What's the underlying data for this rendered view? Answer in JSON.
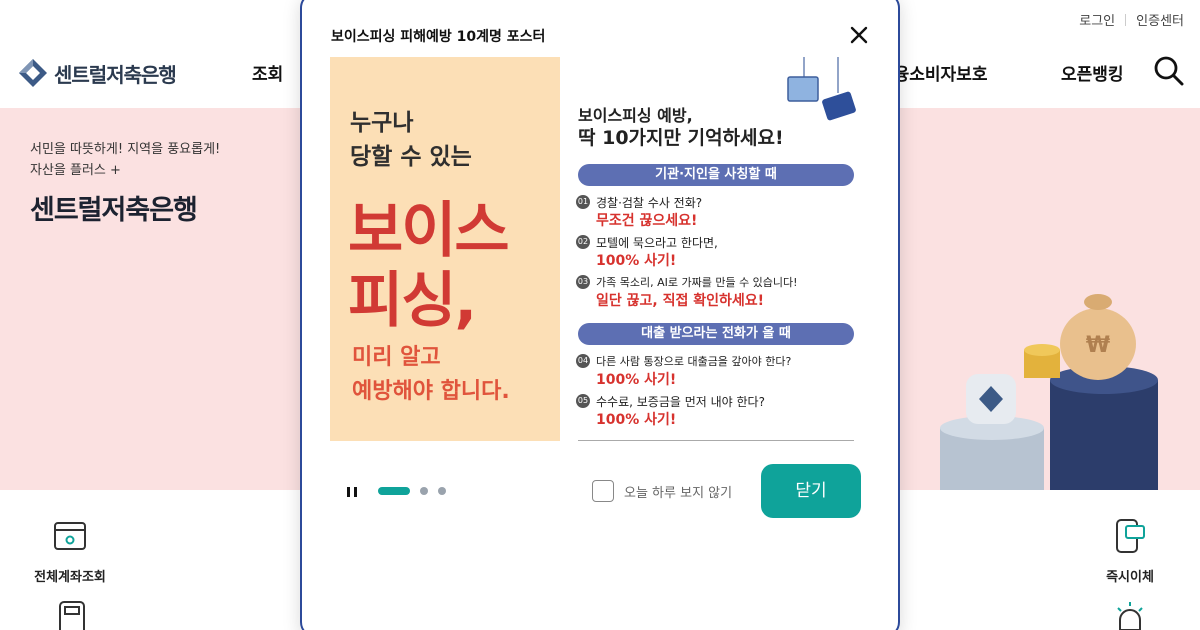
{
  "header": {
    "util_links": [
      "로그인",
      "인증센터"
    ],
    "bank_name": "센트럴저축은행",
    "menu": [
      "조회",
      "금융소비자보호",
      "오픈뱅킹"
    ],
    "search_icon": "search-icon"
  },
  "hero": {
    "slogan_line1": "서민을 따뜻하게! 지역을 풍요롭게!",
    "slogan_line2": "자산을 플러스 +",
    "bank_name": "센트럴저축은행"
  },
  "quick_menu": {
    "left": [
      "전체계좌조회"
    ],
    "right": [
      "즉시이체"
    ]
  },
  "modal": {
    "title": "보이스피싱 피해예방 10계명 포스터",
    "close_icon": "close-icon",
    "poster": {
      "left_line1": "누구나",
      "left_line2": "당할 수 있는",
      "left_big1": "보이스",
      "left_big2": "피싱,",
      "left_bottom1": "미리 알고",
      "left_bottom2": "예방해야 합니다.",
      "right_heading1": "보이스피싱 예방,",
      "right_heading2": "딱 10가지만 기억하세요!",
      "section1": "기관·지인을 사칭할 때",
      "section2": "대출 받으라는 전화가 올 때",
      "items": [
        {
          "num": "01",
          "text": "경찰·검찰 수사 전화?",
          "answer": "무조건 끊으세요!"
        },
        {
          "num": "02",
          "text": "모텔에 묵으라고 한다면,",
          "answer": "100% 사기!"
        },
        {
          "num": "03",
          "text": "가족 목소리, AI로 가짜를 만들 수 있습니다!",
          "answer": "일단 끊고, 직접 확인하세요!"
        },
        {
          "num": "04",
          "text": "다른 사람 통장으로 대출금을 갚아야 한다?",
          "answer": "100% 사기!"
        },
        {
          "num": "05",
          "text": "수수료, 보증금을 먼저 내야 한다?",
          "answer": "100% 사기!"
        }
      ]
    },
    "slides": {
      "total": 3,
      "active": 1
    },
    "dont_show_today": "오늘 하루 보지 않기",
    "close_label": "닫기",
    "accent": "#0fa39a"
  }
}
